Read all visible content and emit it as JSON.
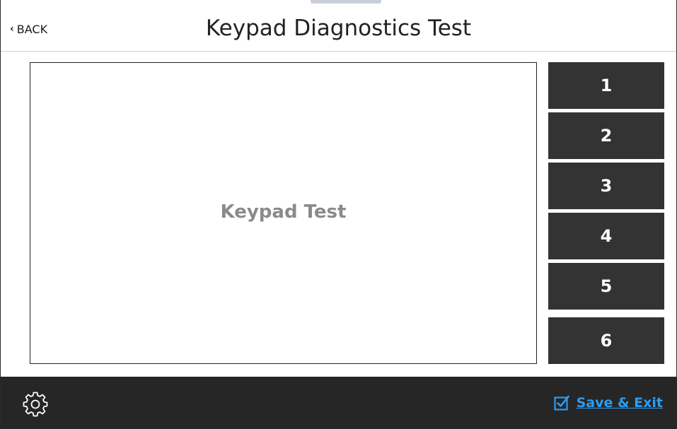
{
  "header": {
    "back_label": "BACK",
    "title": "Keypad Diagnostics Test"
  },
  "test_area": {
    "label": "Keypad Test"
  },
  "keypad": {
    "keys": [
      "1",
      "2",
      "3",
      "4",
      "5",
      "6"
    ]
  },
  "footer": {
    "settings_icon": "gear-icon",
    "save_icon": "checkbox-checked-icon",
    "save_label": "Save & Exit"
  },
  "colors": {
    "key_bg": "#333333",
    "footer_bg": "#262626",
    "accent": "#2b9df2",
    "test_label": "#8a8a8a"
  }
}
